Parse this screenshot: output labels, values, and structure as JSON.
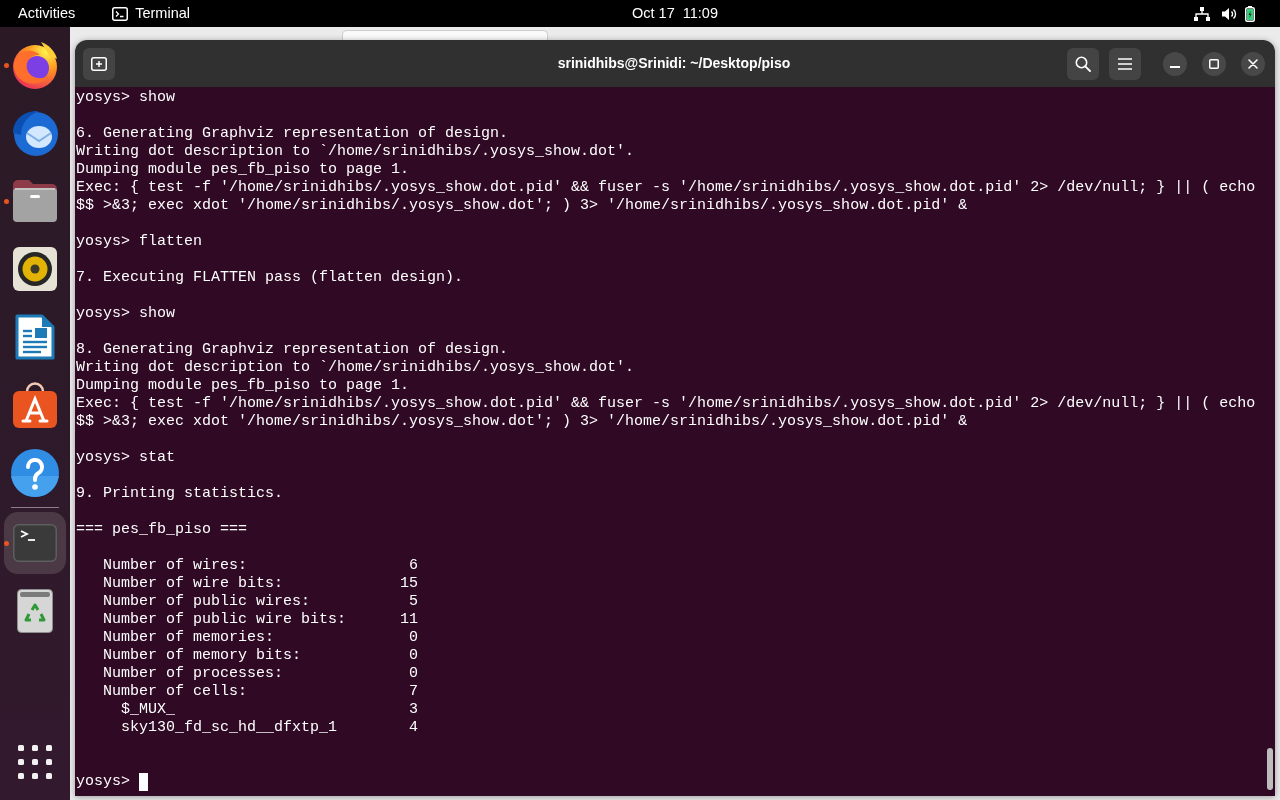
{
  "top_bar": {
    "activities": "Activities",
    "app_menu": "Terminal",
    "clock": "Oct 17  11:09"
  },
  "dock": {
    "favorites": [
      {
        "kind": "browser",
        "running": true,
        "selected": false
      },
      {
        "kind": "mail",
        "running": false,
        "selected": false
      },
      {
        "kind": "files",
        "running": true,
        "selected": false
      },
      {
        "kind": "music",
        "running": false,
        "selected": false
      },
      {
        "kind": "writer",
        "running": false,
        "selected": false
      },
      {
        "kind": "store",
        "running": false,
        "selected": false
      },
      {
        "kind": "help",
        "running": false,
        "selected": false
      }
    ],
    "others": [
      {
        "kind": "terminal",
        "running": true,
        "selected": true
      },
      {
        "kind": "trash",
        "running": false,
        "selected": false
      }
    ]
  },
  "window": {
    "title": "srinidhibs@Srinidi: ~/Desktop/piso"
  },
  "terminal": {
    "blocks": [
      {
        "kind": "text",
        "lines": [
          "yosys> show"
        ]
      },
      {
        "kind": "text",
        "lines": [
          "6. Generating Graphviz representation of design.",
          "Writing dot description to `/home/srinidhibs/.yosys_show.dot'.",
          "Dumping module pes_fb_piso to page 1.",
          "Exec: { test -f '/home/srinidhibs/.yosys_show.dot.pid' && fuser -s '/home/srinidhibs/.yosys_show.dot.pid' 2> /dev/null; } || ( echo",
          "$$ >&3; exec xdot '/home/srinidhibs/.yosys_show.dot'; ) 3> '/home/srinidhibs/.yosys_show.dot.pid' &"
        ]
      },
      {
        "kind": "text",
        "lines": [
          "yosys> flatten"
        ]
      },
      {
        "kind": "text",
        "lines": [
          "7. Executing FLATTEN pass (flatten design)."
        ]
      },
      {
        "kind": "text",
        "lines": [
          "yosys> show"
        ]
      },
      {
        "kind": "text",
        "lines": [
          "8. Generating Graphviz representation of design.",
          "Writing dot description to `/home/srinidhibs/.yosys_show.dot'.",
          "Dumping module pes_fb_piso to page 1.",
          "Exec: { test -f '/home/srinidhibs/.yosys_show.dot.pid' && fuser -s '/home/srinidhibs/.yosys_show.dot.pid' 2> /dev/null; } || ( echo",
          "$$ >&3; exec xdot '/home/srinidhibs/.yosys_show.dot'; ) 3> '/home/srinidhibs/.yosys_show.dot.pid' &"
        ]
      },
      {
        "kind": "text",
        "lines": [
          "yosys> stat"
        ]
      },
      {
        "kind": "text",
        "lines": [
          "9. Printing statistics."
        ]
      },
      {
        "kind": "text",
        "lines": [
          "=== pes_fb_piso ==="
        ]
      },
      {
        "kind": "stats",
        "rows": [
          {
            "label": "Number of wires:",
            "value": "6"
          },
          {
            "label": "Number of wire bits:",
            "value": "15"
          },
          {
            "label": "Number of public wires:",
            "value": "5"
          },
          {
            "label": "Number of public wire bits:",
            "value": "11"
          },
          {
            "label": "Number of memories:",
            "value": "0"
          },
          {
            "label": "Number of memory bits:",
            "value": "0"
          },
          {
            "label": "Number of processes:",
            "value": "0"
          },
          {
            "label": "Number of cells:",
            "value": "7",
            "children": [
              {
                "label": "$_MUX_",
                "value": "3"
              },
              {
                "label": "sky130_fd_sc_hd__dfxtp_1",
                "value": "4"
              }
            ]
          }
        ]
      }
    ],
    "prompt": {
      "text": "yosys>",
      "cursor": true
    }
  }
}
